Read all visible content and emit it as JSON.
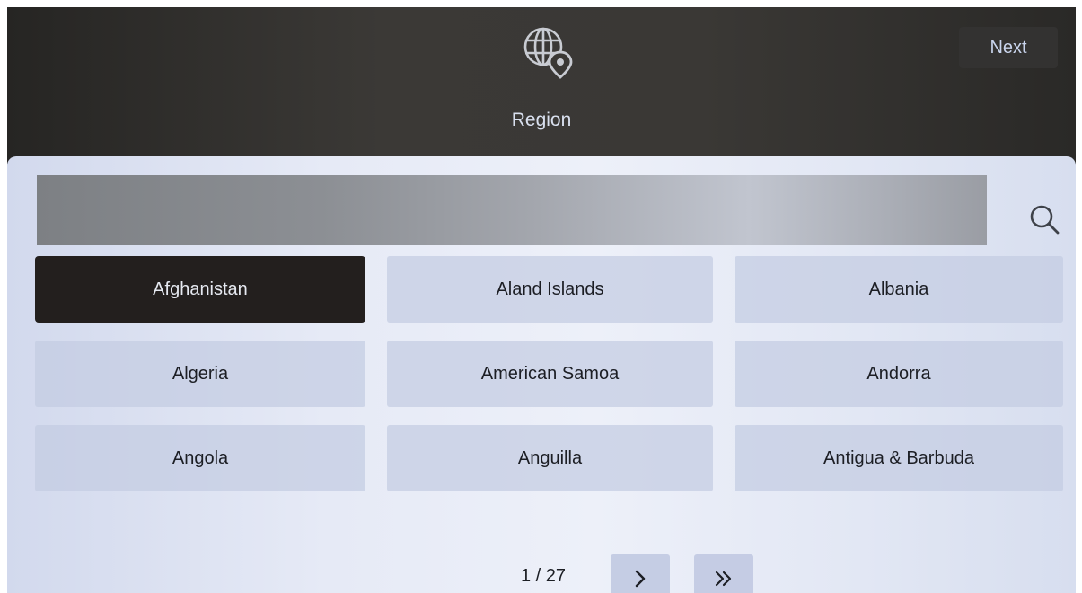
{
  "header": {
    "icon": "globe-location-icon",
    "title": "Region",
    "next_label": "Next"
  },
  "search": {
    "value": "",
    "placeholder": "",
    "icon": "search-icon"
  },
  "regions": [
    {
      "label": "Afghanistan",
      "selected": true
    },
    {
      "label": "Aland Islands",
      "selected": false
    },
    {
      "label": "Albania",
      "selected": false
    },
    {
      "label": "Algeria",
      "selected": false
    },
    {
      "label": "American Samoa",
      "selected": false
    },
    {
      "label": "Andorra",
      "selected": false
    },
    {
      "label": "Angola",
      "selected": false
    },
    {
      "label": "Anguilla",
      "selected": false
    },
    {
      "label": "Antigua & Barbuda",
      "selected": false
    }
  ],
  "pagination": {
    "indicator": "1 / 27",
    "current_page": 1,
    "total_pages": 27,
    "next_icon": "chevron-right-icon",
    "last_icon": "double-chevron-right-icon"
  },
  "colors": {
    "selected_bg": "#231f1e",
    "item_bg": "#c4cce2",
    "header_bg": "#3a3835",
    "header_text": "#d9e0ef"
  }
}
